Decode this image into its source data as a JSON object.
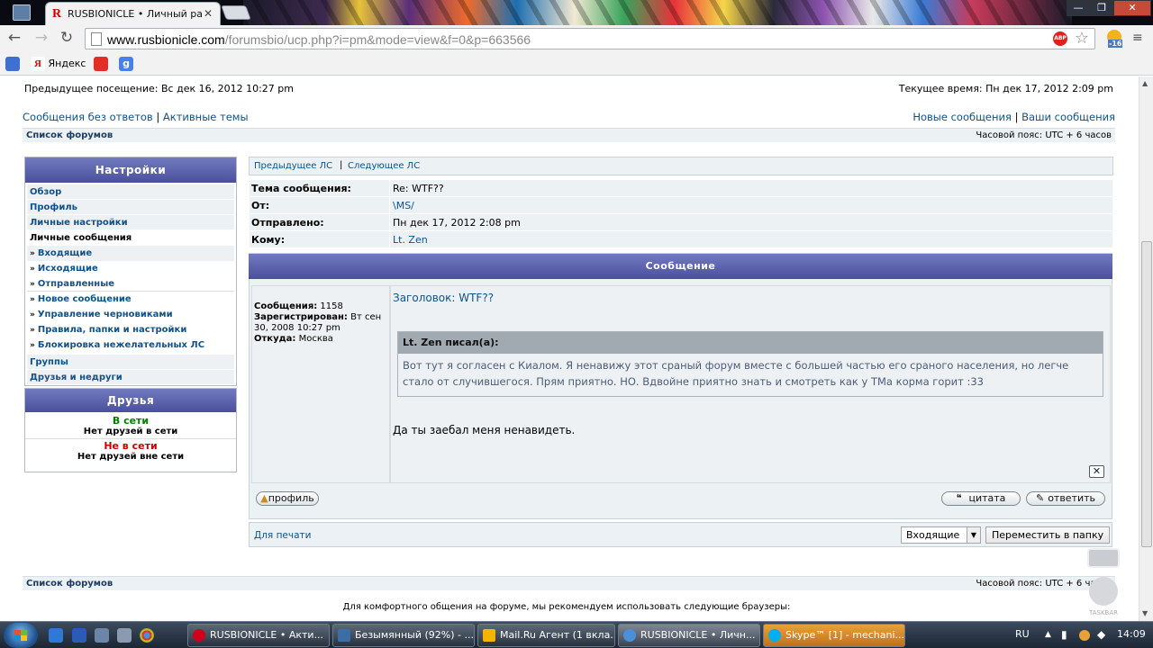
{
  "browser": {
    "tab_title": "RUSBIONICLE • Личный раз",
    "tab_favicon": "R",
    "url_host": "www.rusbionicle.com",
    "url_path": "/forumsbio/ucp.php?i=pm&mode=view&f=0&p=663566",
    "adblock_label": "ABP",
    "weather_temp": "-16",
    "bookmarks": [
      {
        "label": "",
        "icon": "translate-icon"
      },
      {
        "label": "Яндекс",
        "icon": "yandex-icon"
      },
      {
        "label": "",
        "icon": "youtube-icon"
      },
      {
        "label": "",
        "icon": "google-icon"
      }
    ]
  },
  "forum": {
    "last_visit": "Предыдущее посещение: Вс дек 16, 2012 10:27 pm",
    "current_time": "Текущее время: Пн дек 17, 2012 2:09 pm",
    "links_left": [
      "Сообщения без ответов",
      "Активные темы"
    ],
    "links_right": [
      "Новые сообщения",
      "Ваши сообщения"
    ],
    "separator": "|",
    "forum_list": "Список форумов",
    "timezone": "Часовой пояс: UTC + 6 часов"
  },
  "sidebar": {
    "settings_title": "Настройки",
    "items": [
      {
        "label": "Обзор"
      },
      {
        "label": "Профиль"
      },
      {
        "label": "Личные настройки"
      },
      {
        "label": "Личные сообщения"
      }
    ],
    "pm_items": [
      {
        "label": "Входящие"
      },
      {
        "label": "Исходящие"
      },
      {
        "label": "Отправленные"
      },
      {
        "label": "Новое сообщение"
      },
      {
        "label": "Управление черновиками"
      },
      {
        "label": "Правила, папки и настройки"
      },
      {
        "label": "Блокировка нежелательных ЛС"
      }
    ],
    "after_items": [
      {
        "label": "Группы"
      },
      {
        "label": "Друзья и недруги"
      }
    ],
    "friends_title": "Друзья",
    "online_label": "В сети",
    "online_none": "Нет друзей в сети",
    "offline_label": "Не в сети",
    "offline_none": "Нет друзей вне сети"
  },
  "pm": {
    "prev_pm": "Предыдущее ЛС",
    "next_pm": "Следующее ЛС",
    "fields": [
      {
        "key": "Тема сообщения:",
        "value": "Re: WTF??"
      },
      {
        "key": "От:",
        "value": "\\MS/"
      },
      {
        "key": "Отправлено:",
        "value": "Пн дек 17, 2012 2:08 pm"
      },
      {
        "key": "Кому:",
        "value": "Lt. Zen"
      }
    ],
    "message_header": "Сообщение",
    "author_posts_label": "Сообщения:",
    "author_posts": "1158",
    "author_reg_label": "Зарегистрирован:",
    "author_reg": "Вт сен 30, 2008 10:27 pm",
    "author_from_label": "Откуда:",
    "author_from": "Москва",
    "subject": "Заголовок: WTF??",
    "quote_author": "Lt. Zen писал(а):",
    "quote_text": "Вот тут я согласен с Киалом. Я ненавижу этот сраный форум вместе с большей частью его сраного населения, но легче стало от случившегося. Прям приятно. НО. Вдвойне приятно знать и смотреть как у ТМа корма горит :33",
    "body_text": "Да ты заебал меня ненавидеть.",
    "profile_btn": "профиль",
    "quote_btn": "цитата",
    "reply_btn": "ответить",
    "print_link": "Для печати",
    "folder_select": "Входящие",
    "move_btn": "Переместить в папку"
  },
  "footer": {
    "browsers_note": "Для комфортного общения на форуме, мы рекомендуем использовать следующие браузеры:",
    "overlay_label": "TASKBAR"
  },
  "taskbar": {
    "items": [
      {
        "label": "RUSBIONICLE • Акти...",
        "color": "#d0021b"
      },
      {
        "label": "Безымянный (92%) - ...",
        "color": "#3a6ea5"
      },
      {
        "label": "Mail.Ru Агент (1 вкла...",
        "color": "#f5b400"
      },
      {
        "label": "RUSBIONICLE • Личн...",
        "color": "#4a90d9"
      },
      {
        "label": "Skype™ [1] - mechani...",
        "color": "#00aff0"
      }
    ],
    "lang": "RU",
    "clock": "14:09"
  }
}
